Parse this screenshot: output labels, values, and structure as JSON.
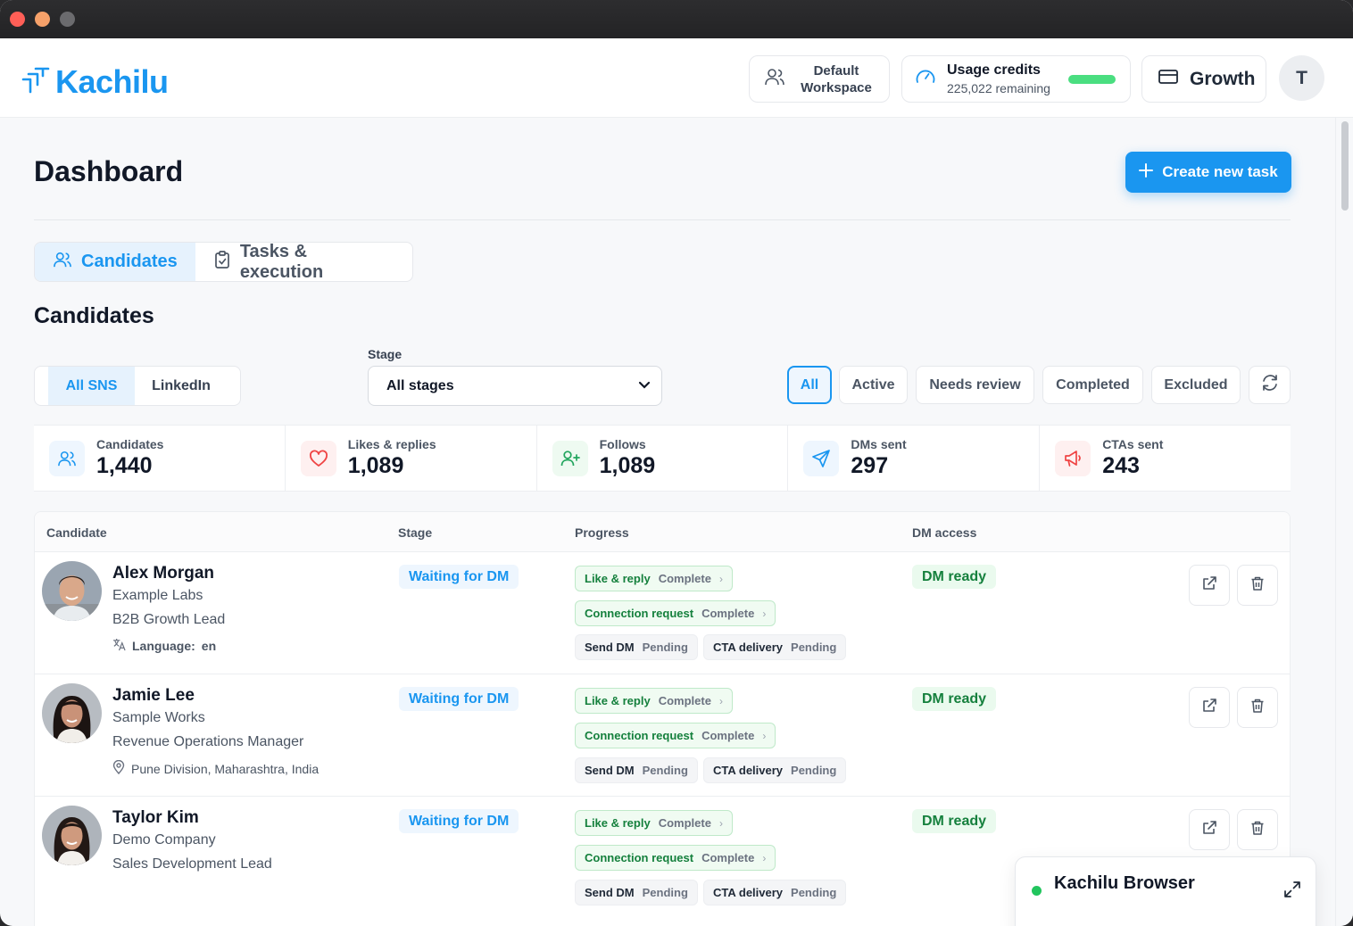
{
  "app": {
    "logo_text": "Kachilu",
    "brand_color": "#1a96f0"
  },
  "header": {
    "workspace_label": "Default Workspace",
    "credits_title": "Usage credits",
    "credits_remaining": "225,022 remaining",
    "plan_label": "Growth",
    "user_initial": "T"
  },
  "page": {
    "title": "Dashboard",
    "create_button": "Create new task"
  },
  "tabs": [
    {
      "label": "Candidates",
      "active": true,
      "icon": "users-icon"
    },
    {
      "label": "Tasks & execution",
      "active": false,
      "icon": "clipboard-check-icon"
    }
  ],
  "section_title": "Candidates",
  "sns_filter": {
    "options": [
      "All SNS",
      "LinkedIn"
    ],
    "selected": "All SNS"
  },
  "stage_filter": {
    "label": "Stage",
    "value": "All stages"
  },
  "status_filters": {
    "options": [
      "All",
      "Active",
      "Needs review",
      "Completed",
      "Excluded"
    ],
    "selected": "All"
  },
  "stats": [
    {
      "label": "Candidates",
      "value": "1,440",
      "icon": "users-icon",
      "color": "#1a96f0"
    },
    {
      "label": "Likes & replies",
      "value": "1,089",
      "icon": "heart-icon",
      "color": "#ef4444"
    },
    {
      "label": "Follows",
      "value": "1,089",
      "icon": "user-plus-icon",
      "color": "#22a55e"
    },
    {
      "label": "DMs sent",
      "value": "297",
      "icon": "send-icon",
      "color": "#1a96f0"
    },
    {
      "label": "CTAs sent",
      "value": "243",
      "icon": "megaphone-icon",
      "color": "#ef4444"
    }
  ],
  "table": {
    "columns": [
      "Candidate",
      "Stage",
      "Progress",
      "DM access"
    ],
    "rows": [
      {
        "name": "Alex Morgan",
        "company": "Example Labs",
        "title": "B2B Growth Lead",
        "extra_icon": "translate-icon",
        "extra_label": "Language:",
        "extra_value": "en",
        "stage": "Waiting for DM",
        "progress": [
          {
            "label": "Like & reply",
            "status": "Complete"
          },
          {
            "label": "Connection request",
            "status": "Complete"
          },
          {
            "label": "Send DM",
            "status": "Pending"
          },
          {
            "label": "CTA delivery",
            "status": "Pending"
          }
        ],
        "dm_access": "DM ready"
      },
      {
        "name": "Jamie Lee",
        "company": "Sample Works",
        "title": "Revenue Operations Manager",
        "extra_icon": "location-pin-icon",
        "extra_label": "",
        "extra_value": "Pune Division, Maharashtra, India",
        "stage": "Waiting for DM",
        "progress": [
          {
            "label": "Like & reply",
            "status": "Complete"
          },
          {
            "label": "Connection request",
            "status": "Complete"
          },
          {
            "label": "Send DM",
            "status": "Pending"
          },
          {
            "label": "CTA delivery",
            "status": "Pending"
          }
        ],
        "dm_access": "DM ready"
      },
      {
        "name": "Taylor Kim",
        "company": "Demo Company",
        "title": "Sales Development Lead",
        "extra_icon": "",
        "extra_label": "",
        "extra_value": "",
        "stage": "Waiting for DM",
        "progress": [
          {
            "label": "Like & reply",
            "status": "Complete"
          },
          {
            "label": "Connection request",
            "status": "Complete"
          },
          {
            "label": "Send DM",
            "status": "Pending"
          },
          {
            "label": "CTA delivery",
            "status": "Pending"
          }
        ],
        "dm_access": "DM ready"
      }
    ]
  },
  "browser_panel": {
    "title": "Kachilu Browser",
    "status_color": "#22c55e"
  }
}
